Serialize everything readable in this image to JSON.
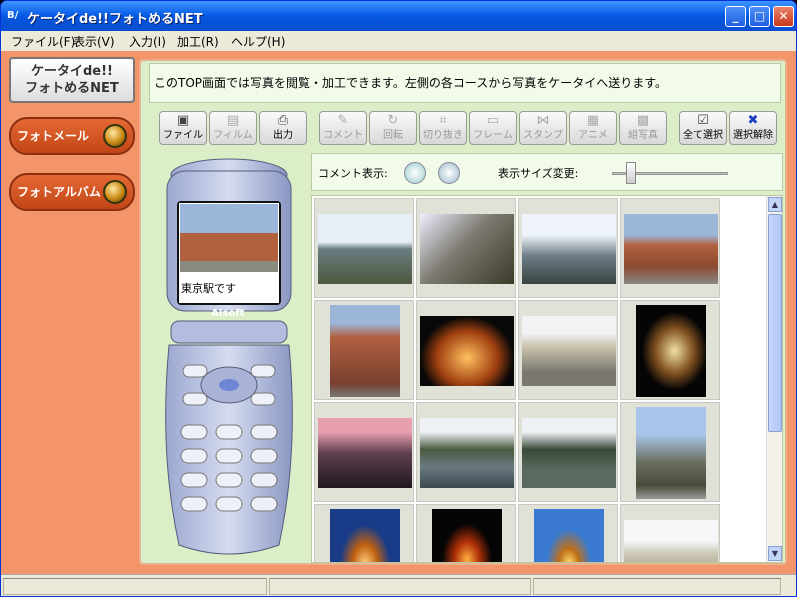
{
  "window": {
    "title": "ケータイde!!フォトめるNET",
    "minimize": "_",
    "maximize": "□",
    "close": "✕"
  },
  "menu": [
    "ファイル(F)",
    "表示(V)",
    "入力(I)",
    "加工(R)",
    "ヘルプ(H)"
  ],
  "logo": {
    "line1": "ケータイde!!",
    "line2": "フォトめるNET"
  },
  "nav": [
    {
      "label": "フォトメール"
    },
    {
      "label": "フォトアルバム"
    }
  ],
  "info_text": "このTOP画面では写真を閲覧・加工できます。左側の各コースから写真をケータイへ送ります。",
  "toolbar": [
    {
      "label": "ファイル",
      "icon": "file-icon",
      "enabled": true
    },
    {
      "label": "フィルム",
      "icon": "film-icon",
      "enabled": false
    },
    {
      "label": "出力",
      "icon": "output-icon",
      "enabled": true
    },
    {
      "label": "コメント",
      "icon": "comment-icon",
      "enabled": false
    },
    {
      "label": "回転",
      "icon": "rotate-icon",
      "enabled": false
    },
    {
      "label": "切り抜き",
      "icon": "crop-icon",
      "enabled": false
    },
    {
      "label": "フレーム",
      "icon": "frame-icon",
      "enabled": false
    },
    {
      "label": "スタンプ",
      "icon": "stamp-icon",
      "enabled": false
    },
    {
      "label": "アニメ",
      "icon": "anime-icon",
      "enabled": false
    },
    {
      "label": "組写真",
      "icon": "collage-icon",
      "enabled": false
    },
    {
      "label": "全て選択",
      "icon": "select-all-icon",
      "enabled": true
    },
    {
      "label": "選択解除",
      "icon": "deselect-icon",
      "enabled": true
    }
  ],
  "phone": {
    "caption": "東京駅です",
    "brand": "AIsoft"
  },
  "controls": {
    "comment_label": "コメント表示:",
    "size_label": "表示サイズ変更:"
  },
  "colors": {
    "accent": "#f3946a",
    "panel": "#dceec8",
    "nav": "#c34716"
  }
}
